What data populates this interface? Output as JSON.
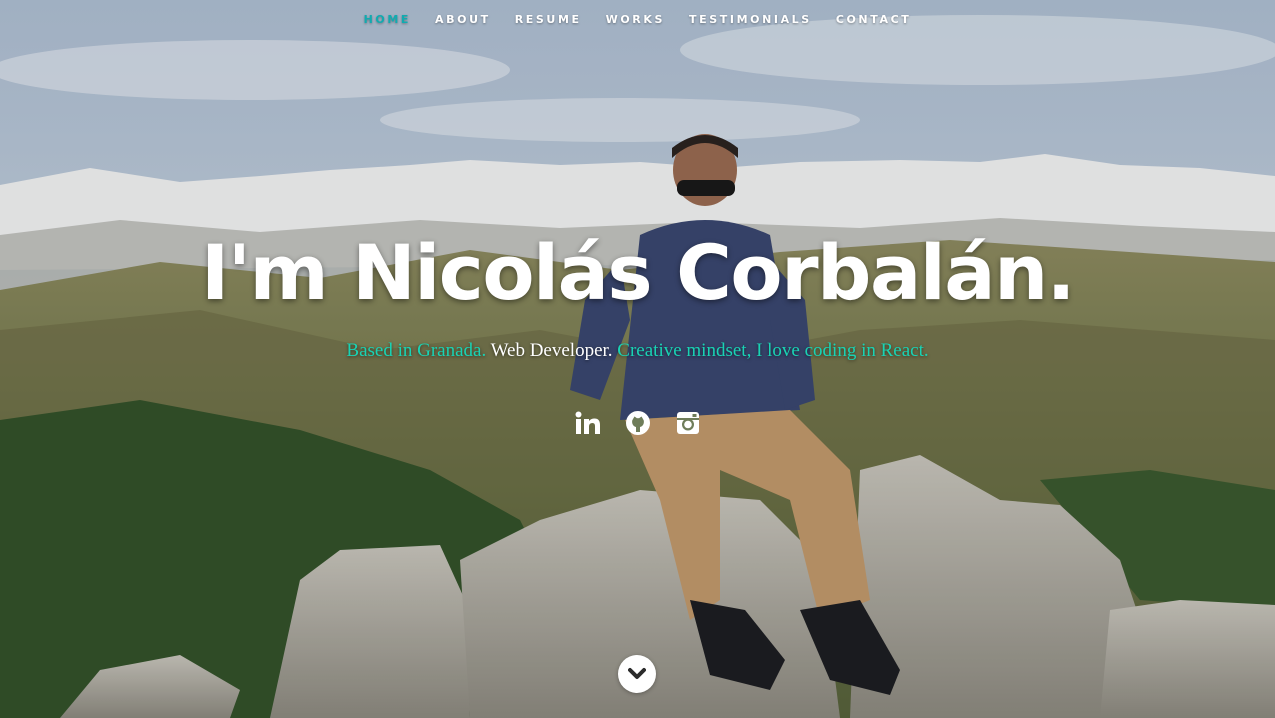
{
  "nav": {
    "items": [
      {
        "label": "HOME",
        "active": true
      },
      {
        "label": "ABOUT",
        "active": false
      },
      {
        "label": "RESUME",
        "active": false
      },
      {
        "label": "WORKS",
        "active": false
      },
      {
        "label": "TESTIMONIALS",
        "active": false
      },
      {
        "label": "CONTACT",
        "active": false
      }
    ]
  },
  "banner": {
    "headline": "I'm Nicolás Corbalán.",
    "tagline_part1": "Based in Granada.",
    "tagline_part2": " Web Developer. ",
    "tagline_part3": "Creative mindset, I love coding in React."
  },
  "social": [
    {
      "icon": "linkedin-icon"
    },
    {
      "icon": "github-icon"
    },
    {
      "icon": "instagram-icon"
    }
  ],
  "scroll_down": {
    "icon": "chevron-down-icon"
  },
  "colors": {
    "accent": "#11abb0",
    "tagline_accent": "#19d3b4",
    "text": "#ffffff"
  }
}
